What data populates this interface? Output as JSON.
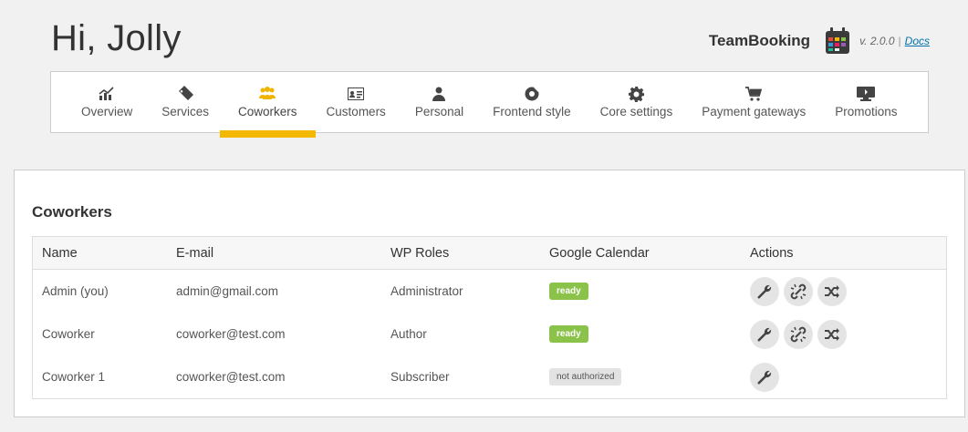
{
  "header": {
    "greeting": "Hi, Jolly",
    "brand_name": "TeamBooking",
    "version": "v. 2.0.0",
    "separator": "|",
    "docs_label": "Docs"
  },
  "tabs": [
    {
      "label": "Overview",
      "icon": "chart-icon"
    },
    {
      "label": "Services",
      "icon": "tag-icon"
    },
    {
      "label": "Coworkers",
      "icon": "users-icon",
      "active": true
    },
    {
      "label": "Customers",
      "icon": "id-card-icon"
    },
    {
      "label": "Personal",
      "icon": "user-icon"
    },
    {
      "label": "Frontend style",
      "icon": "palette-icon"
    },
    {
      "label": "Core settings",
      "icon": "gear-icon"
    },
    {
      "label": "Payment gateways",
      "icon": "cart-icon"
    },
    {
      "label": "Promotions",
      "icon": "promo-icon"
    }
  ],
  "colors": {
    "accent": "#f5b800",
    "ready": "#8bc34a",
    "link": "#0073aa"
  },
  "panel": {
    "title": "Coworkers",
    "columns": [
      "Name",
      "E-mail",
      "WP Roles",
      "Google Calendar",
      "Actions"
    ],
    "rows": [
      {
        "name": "Admin (you)",
        "email": "admin@gmail.com",
        "role": "Administrator",
        "calendar": "ready",
        "actions": [
          "wrench-icon",
          "unlink-icon",
          "shuffle-icon"
        ]
      },
      {
        "name": "Coworker",
        "email": "coworker@test.com",
        "role": "Author",
        "calendar": "ready",
        "actions": [
          "wrench-icon",
          "unlink-icon",
          "shuffle-icon"
        ]
      },
      {
        "name": "Coworker 1",
        "email": "coworker@test.com",
        "role": "Subscriber",
        "calendar": "not authorized",
        "actions": [
          "wrench-icon"
        ]
      }
    ]
  }
}
